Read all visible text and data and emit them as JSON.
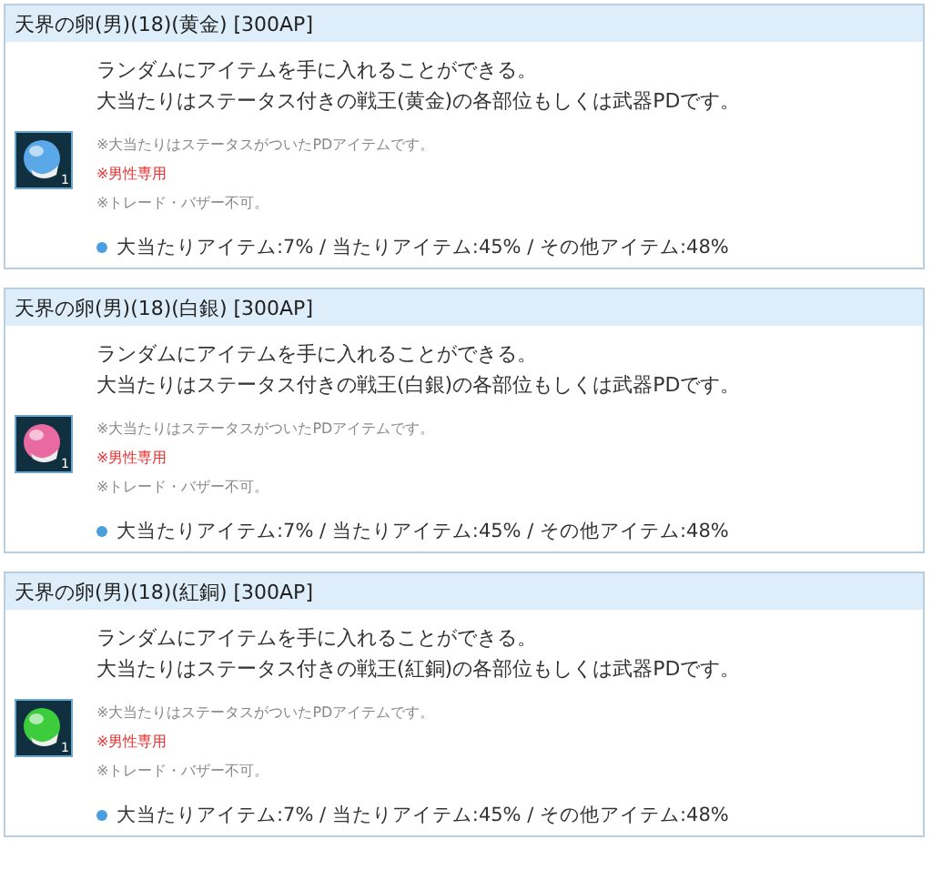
{
  "items": [
    {
      "title": "天界の卵(男)(18)(黄金) [300AP]",
      "icon": {
        "color": "#5aa8e8",
        "count": "1"
      },
      "description": [
        "ランダムにアイテムを手に入れることができる。",
        "大当たりはステータス付きの戦王(黄金)の各部位もしくは武器PDです。"
      ],
      "notes": [
        {
          "kind": "normal",
          "text": "※大当たりはステータスがついたPDアイテムです。"
        },
        {
          "kind": "warning",
          "text": "※男性専用"
        },
        {
          "kind": "normal",
          "text": "※トレード・バザー不可。"
        }
      ],
      "rates": "大当たりアイテム:7% / 当たりアイテム:45% / その他アイテム:48%"
    },
    {
      "title": "天界の卵(男)(18)(白銀) [300AP]",
      "icon": {
        "color": "#e86aa0",
        "count": "1"
      },
      "description": [
        "ランダムにアイテムを手に入れることができる。",
        "大当たりはステータス付きの戦王(白銀)の各部位もしくは武器PDです。"
      ],
      "notes": [
        {
          "kind": "normal",
          "text": "※大当たりはステータスがついたPDアイテムです。"
        },
        {
          "kind": "warning",
          "text": "※男性専用"
        },
        {
          "kind": "normal",
          "text": "※トレード・バザー不可。"
        }
      ],
      "rates": "大当たりアイテム:7% / 当たりアイテム:45% / その他アイテム:48%"
    },
    {
      "title": "天界の卵(男)(18)(紅銅) [300AP]",
      "icon": {
        "color": "#3ccc3c",
        "count": "1"
      },
      "description": [
        "ランダムにアイテムを手に入れることができる。",
        "大当たりはステータス付きの戦王(紅銅)の各部位もしくは武器PDです。"
      ],
      "notes": [
        {
          "kind": "normal",
          "text": "※大当たりはステータスがついたPDアイテムです。"
        },
        {
          "kind": "warning",
          "text": "※男性専用"
        },
        {
          "kind": "normal",
          "text": "※トレード・バザー不可。"
        }
      ],
      "rates": "大当たりアイテム:7% / 当たりアイテム:45% / その他アイテム:48%"
    }
  ]
}
